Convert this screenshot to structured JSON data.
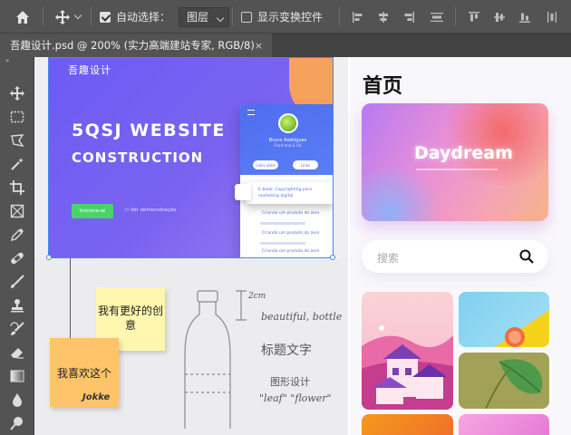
{
  "options_bar": {
    "auto_select_label": "自动选择：",
    "auto_select_checked": true,
    "layer_select_value": "图层",
    "show_transform_label": "显示变换控件",
    "show_transform_checked": false
  },
  "document_tab": {
    "title": "吾趣设计.psd @ 200% (实力高端建站专家, RGB/8)",
    "close_symbol": "×"
  },
  "toolbar": {
    "header": "»",
    "tools": [
      "move-tool",
      "marquee-tool",
      "lasso-tool",
      "magic-wand-tool",
      "crop-tool",
      "frame-tool",
      "eyedropper-tool",
      "healing-brush-tool",
      "brush-tool",
      "clone-stamp-tool",
      "history-brush-tool",
      "eraser-tool",
      "gradient-tool",
      "blur-tool",
      "dodge-tool"
    ]
  },
  "hero": {
    "brand": "吾趣设计",
    "title": "5QSJ  WEBSITE",
    "subtitle": "CONSTRUCTION",
    "cta": "Inscreva-se",
    "demo": "Ver demonstração",
    "card": {
      "name": "Bruno Rodrigues",
      "role": "Front-end & UX",
      "pill1": "Links úteis",
      "pill2": "Links",
      "floating": "E-book: Copyrighting para marketing digital",
      "items": [
        "Criando um produto do zero",
        "Criando um produto do zero",
        "Criando um produto do zero"
      ]
    }
  },
  "sketch": {
    "sticky1": "我有更好的创意",
    "sticky2": "我喜欢这个",
    "signature": "Jokke",
    "notes": [
      "2cm",
      "beautiful, bottle",
      "标题文字",
      "图形设计",
      "\"leaf\" \"flower\""
    ]
  },
  "mobile": {
    "title": "首页",
    "banner_word": "Daydream",
    "search_placeholder": "搜索"
  },
  "colors": {
    "ps_bg": "#535353",
    "hero_purple": "#6c5cf4",
    "selection_blue": "#3d8bf0",
    "sticky_yellow": "#fff7b0",
    "sticky_orange": "#ffc46a"
  }
}
